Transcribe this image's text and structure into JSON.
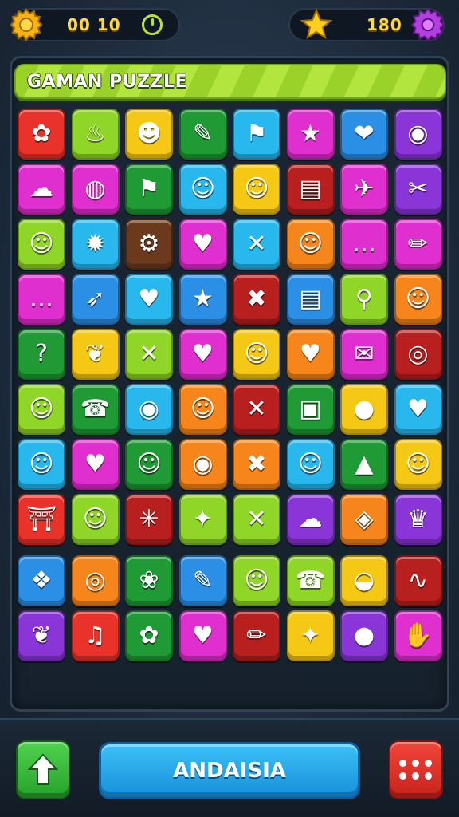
{
  "header": {
    "left_score": "00 10",
    "right_score": "180",
    "coin_icon": "gear-coin-icon",
    "timer_icon": "timer-icon",
    "star_icon": "star-icon",
    "settings_icon": "purple-gear-icon"
  },
  "title": "GAMAN PUZZLE",
  "colors": {
    "red": "#e8322a",
    "yellow": "#f5c816",
    "lime": "#8fd628",
    "green": "#1f9a35",
    "cyan": "#28b8ee",
    "magenta": "#e02fcf",
    "blue": "#2c8fe6",
    "purple": "#8a35d8",
    "orange": "#f6861c",
    "brown": "#6b3a1c",
    "darkred": "#b81f1f"
  },
  "grid": [
    [
      {
        "c": "red",
        "g": "✿",
        "n": "flower-icon"
      },
      {
        "c": "lime",
        "g": "♨",
        "n": "balloon-icon"
      },
      {
        "c": "yellow",
        "g": "☻",
        "n": "devil-face-icon"
      },
      {
        "c": "green",
        "g": "✎",
        "n": "brush-icon"
      },
      {
        "c": "cyan",
        "g": "⚑",
        "n": "flag-icon"
      },
      {
        "c": "magenta",
        "g": "★",
        "n": "star-icon"
      },
      {
        "c": "blue",
        "g": "❤",
        "n": "heart-shield-icon"
      },
      {
        "c": "purple",
        "g": "◉",
        "n": "magnifier-icon"
      }
    ],
    [
      {
        "c": "magenta",
        "g": "☁",
        "n": "ghost-icon"
      },
      {
        "c": "magenta",
        "g": "◍",
        "n": "hot-air-balloon-icon"
      },
      {
        "c": "green",
        "g": "⚑",
        "n": "flag-icon"
      },
      {
        "c": "cyan",
        "g": "☺",
        "n": "slime-face-icon"
      },
      {
        "c": "yellow",
        "g": "☺",
        "n": "box-face-icon"
      },
      {
        "c": "darkred",
        "g": "▤",
        "n": "books-icon"
      },
      {
        "c": "magenta",
        "g": "✈",
        "n": "plane-icon"
      },
      {
        "c": "purple",
        "g": "✂",
        "n": "scissors-icon"
      }
    ],
    [
      {
        "c": "lime",
        "g": "☺",
        "n": "smile-face-icon"
      },
      {
        "c": "cyan",
        "g": "✹",
        "n": "sun-star-icon"
      },
      {
        "c": "brown",
        "g": "⚙",
        "n": "gear-icon"
      },
      {
        "c": "magenta",
        "g": "♥",
        "n": "heart-icon"
      },
      {
        "c": "cyan",
        "g": "✕",
        "n": "tools-icon"
      },
      {
        "c": "orange",
        "g": "☺",
        "n": "cookie-face-icon"
      },
      {
        "c": "magenta",
        "g": "…",
        "n": "chat-bubble-icon"
      },
      {
        "c": "magenta",
        "g": "✏",
        "n": "pencil-icon"
      }
    ],
    [
      {
        "c": "magenta",
        "g": "…",
        "n": "speech-bubble-icon"
      },
      {
        "c": "blue",
        "g": "➶",
        "n": "bow-arrow-icon"
      },
      {
        "c": "cyan",
        "g": "♥",
        "n": "berry-heart-icon"
      },
      {
        "c": "blue",
        "g": "★",
        "n": "star-icon"
      },
      {
        "c": "darkred",
        "g": "✖",
        "n": "cross-icon"
      },
      {
        "c": "blue",
        "g": "▤",
        "n": "books-icon"
      },
      {
        "c": "lime",
        "g": "⚲",
        "n": "bone-icon"
      },
      {
        "c": "orange",
        "g": "☺",
        "n": "monster-face-icon"
      }
    ],
    [
      {
        "c": "green",
        "g": "?",
        "n": "question-icon"
      },
      {
        "c": "yellow",
        "g": "❦",
        "n": "leaf-icon"
      },
      {
        "c": "lime",
        "g": "✕",
        "n": "tools-icon"
      },
      {
        "c": "magenta",
        "g": "♥",
        "n": "heart-icon"
      },
      {
        "c": "yellow",
        "g": "☺",
        "n": "flower-face-icon"
      },
      {
        "c": "orange",
        "g": "♥",
        "n": "heart-icon"
      },
      {
        "c": "magenta",
        "g": "✉",
        "n": "envelope-icon"
      },
      {
        "c": "darkred",
        "g": "◎",
        "n": "ring-icon"
      }
    ],
    [
      {
        "c": "lime",
        "g": "☺",
        "n": "star-face-icon"
      },
      {
        "c": "green",
        "g": "☎",
        "n": "phone-icon"
      },
      {
        "c": "cyan",
        "g": "◉",
        "n": "target-icon"
      },
      {
        "c": "orange",
        "g": "☺",
        "n": "cat-face-icon"
      },
      {
        "c": "darkred",
        "g": "✕",
        "n": "tools-icon"
      },
      {
        "c": "green",
        "g": "▣",
        "n": "frame-icon"
      },
      {
        "c": "yellow",
        "g": "●",
        "n": "balloon-icon"
      },
      {
        "c": "cyan",
        "g": "♥",
        "n": "heart-icon"
      }
    ],
    [
      {
        "c": "cyan",
        "g": "☺",
        "n": "duck-face-icon"
      },
      {
        "c": "magenta",
        "g": "♥",
        "n": "heart-icon"
      },
      {
        "c": "green",
        "g": "☺",
        "n": "smile-face-icon"
      },
      {
        "c": "orange",
        "g": "◉",
        "n": "eye-icon"
      },
      {
        "c": "orange",
        "g": "✖",
        "n": "cross-icon"
      },
      {
        "c": "cyan",
        "g": "☺",
        "n": "bubble-face-icon"
      },
      {
        "c": "green",
        "g": "▲",
        "n": "cone-icon"
      },
      {
        "c": "yellow",
        "g": "☺",
        "n": "lion-face-icon"
      }
    ],
    [
      {
        "c": "red",
        "g": "⛩",
        "n": "gate-icon"
      },
      {
        "c": "lime",
        "g": "☺",
        "n": "slime-face-icon"
      },
      {
        "c": "darkred",
        "g": "✳",
        "n": "sparkle-icon"
      },
      {
        "c": "lime",
        "g": "✦",
        "n": "star-flower-icon"
      },
      {
        "c": "lime",
        "g": "✕",
        "n": "tools-icon"
      },
      {
        "c": "purple",
        "g": "☁",
        "n": "ghost-icon"
      },
      {
        "c": "orange",
        "g": "◈",
        "n": "gem-icon"
      },
      {
        "c": "purple",
        "g": "♛",
        "n": "crown-icon"
      }
    ],
    [
      {
        "c": "blue",
        "g": "❖",
        "n": "fish-icon"
      },
      {
        "c": "orange",
        "g": "◎",
        "n": "target-icon"
      },
      {
        "c": "green",
        "g": "❀",
        "n": "palette-icon"
      },
      {
        "c": "blue",
        "g": "✎",
        "n": "brush-icon"
      },
      {
        "c": "lime",
        "g": "☺",
        "n": "pumpkin-face-icon"
      },
      {
        "c": "lime",
        "g": "☎",
        "n": "phone-icon"
      },
      {
        "c": "yellow",
        "g": "◒",
        "n": "bowl-icon"
      },
      {
        "c": "darkred",
        "g": "∿",
        "n": "ribbon-icon"
      }
    ],
    [
      {
        "c": "purple",
        "g": "❦",
        "n": "leaf-icon"
      },
      {
        "c": "red",
        "g": "♫",
        "n": "bell-icon"
      },
      {
        "c": "green",
        "g": "✿",
        "n": "gear-flower-icon"
      },
      {
        "c": "magenta",
        "g": "♥",
        "n": "heart-icon"
      },
      {
        "c": "darkred",
        "g": "✏",
        "n": "pencil-icon"
      },
      {
        "c": "yellow",
        "g": "✦",
        "n": "star-cookie-icon"
      },
      {
        "c": "purple",
        "g": "●",
        "n": "mitten-icon"
      },
      {
        "c": "magenta",
        "g": "✋",
        "n": "thumb-icon"
      }
    ]
  ],
  "footer": {
    "main_button_label": "ANDAISIA",
    "up_icon": "arrow-up-icon",
    "dice_icon": "dice-icon"
  }
}
